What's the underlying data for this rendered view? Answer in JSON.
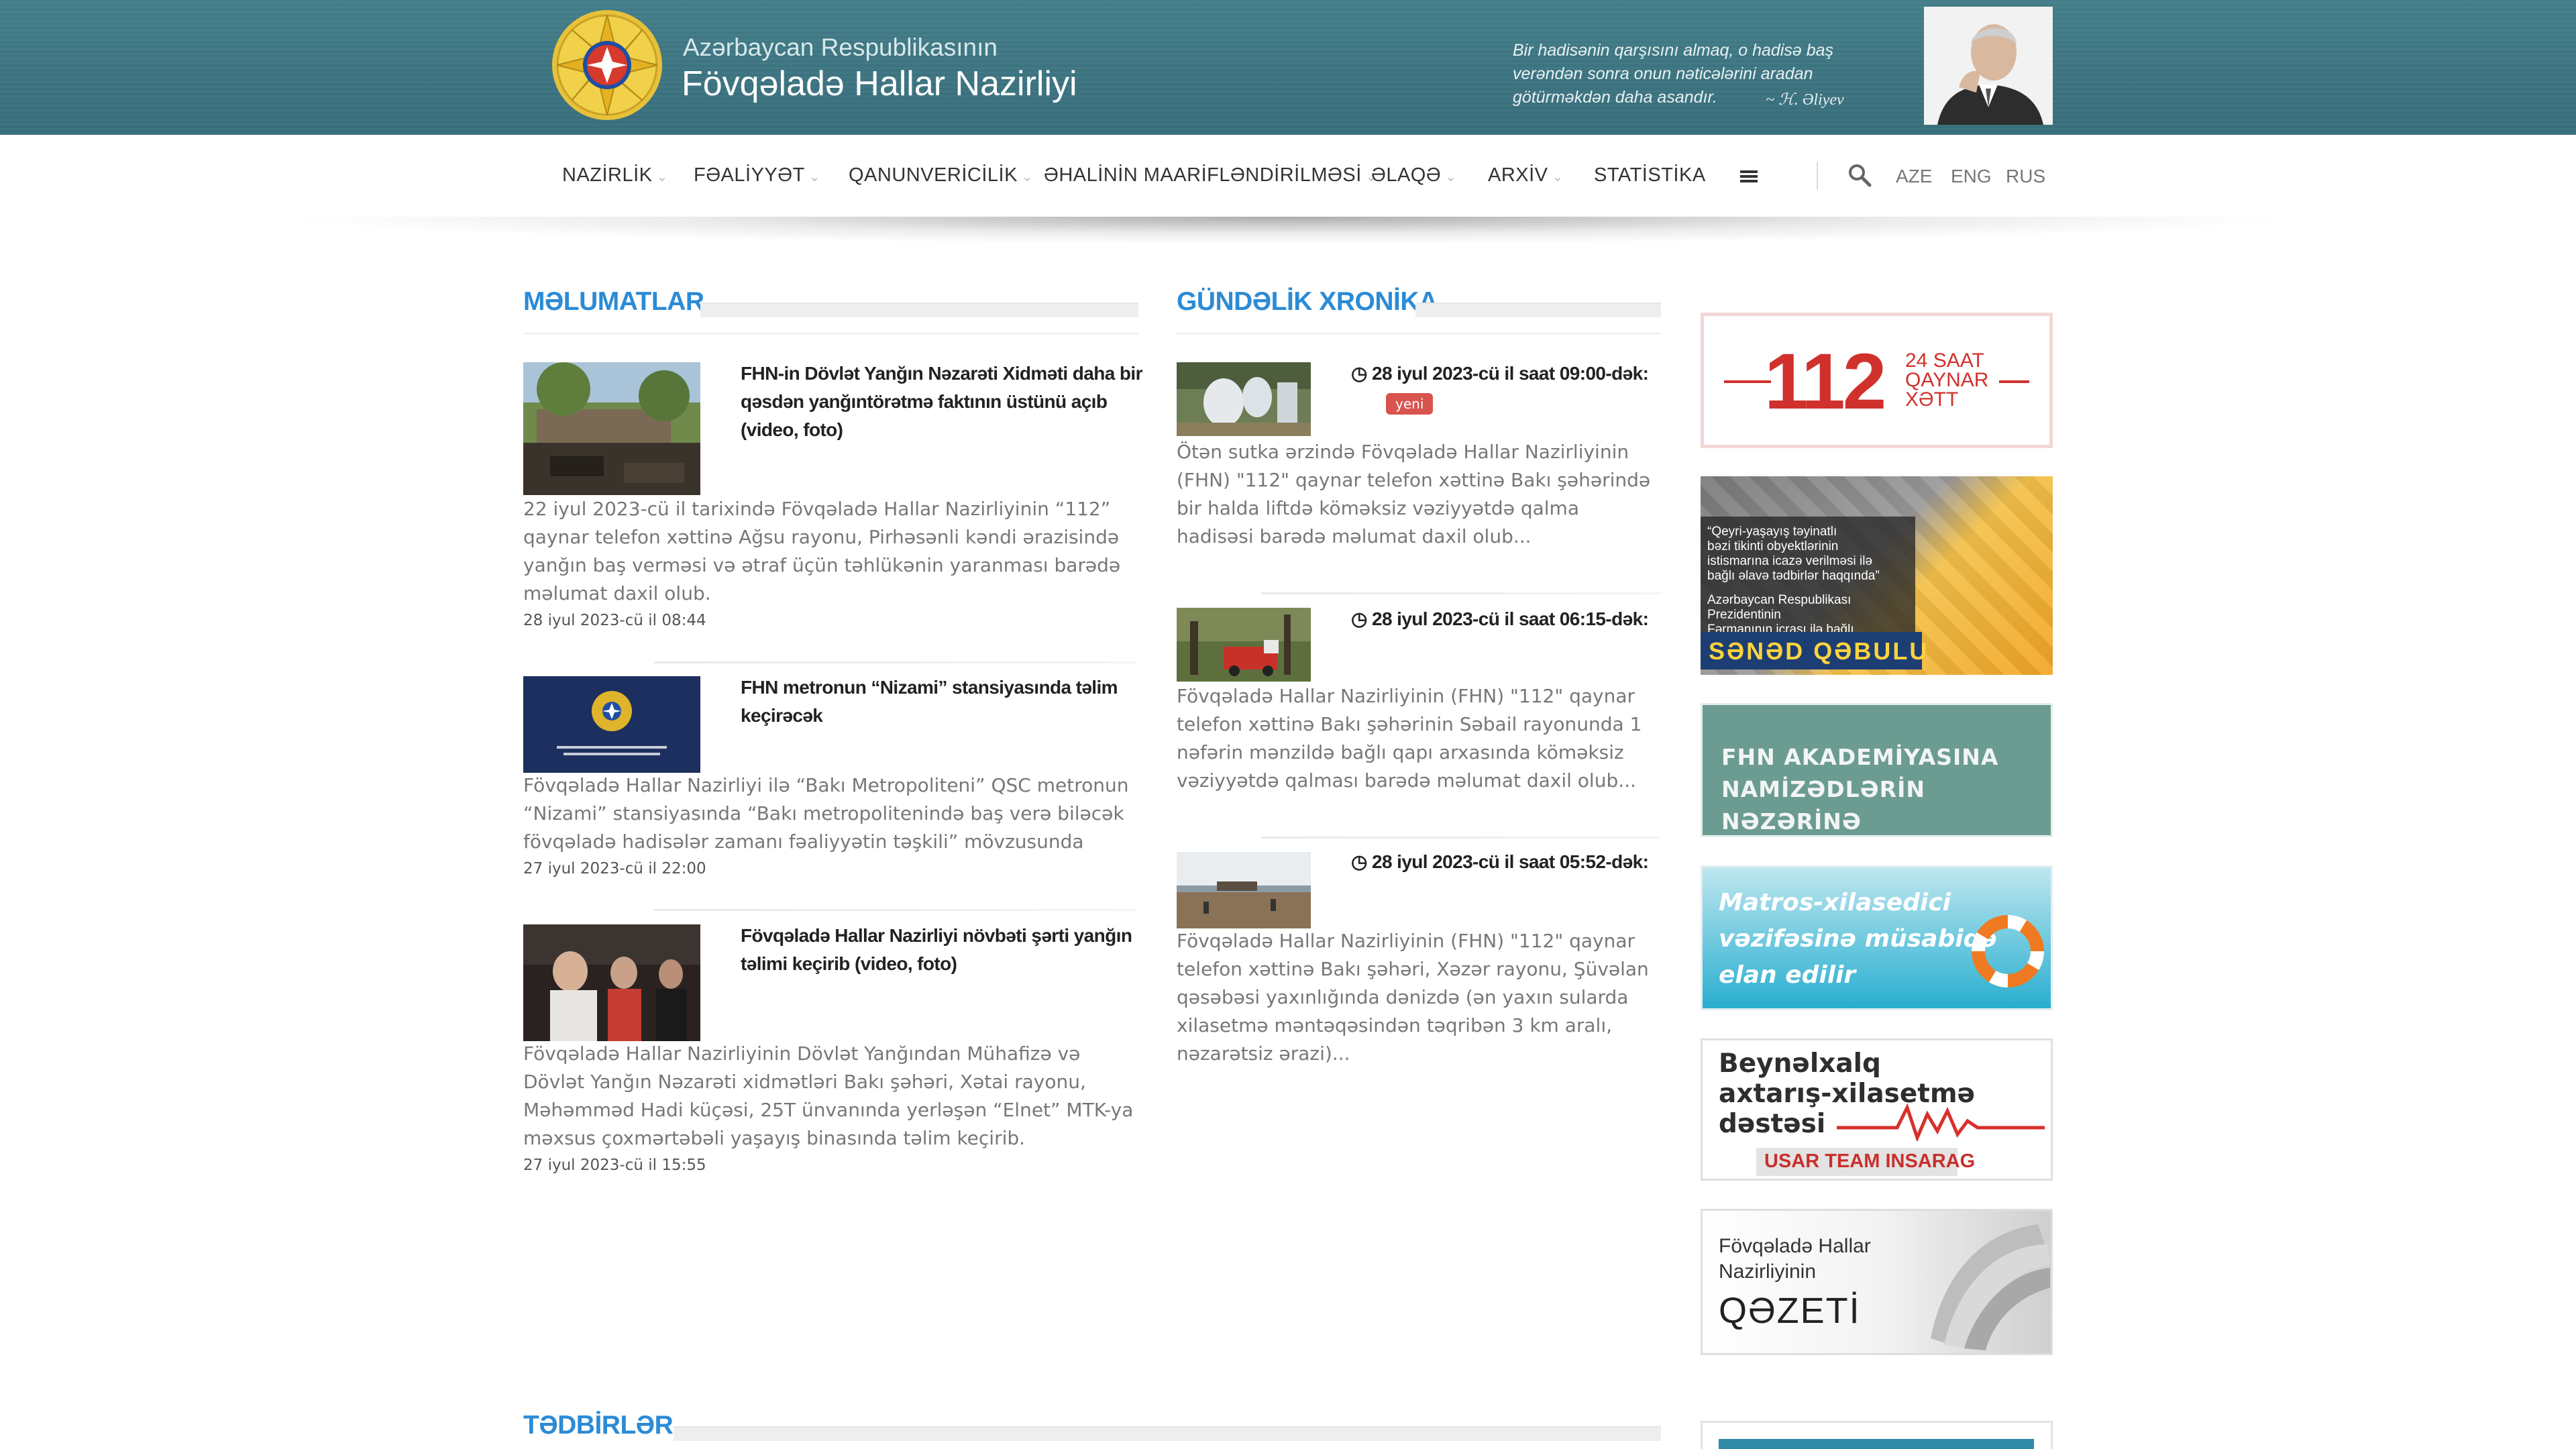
{
  "header": {
    "brand_sub": "Azərbaycan Respublikasının",
    "brand_main": "Fövqəladə Hallar Nazirliyi",
    "quote": "Bir hadisənin qarşısını almaq, o hadisə baş verəndən sonra onun nəticələrini aradan götürməkdən daha asandır."
  },
  "nav": {
    "items": [
      "NAZİRLİK",
      "FƏALİYYƏT",
      "QANUNVERİCİLİK",
      "ƏHALİNİN MAARİFLƏNDİRİLMƏSİ",
      "ƏLAQƏ",
      "ARXİV",
      "STATİSTİKA"
    ],
    "languages": [
      "AZE",
      "ENG",
      "RUS"
    ]
  },
  "sections": {
    "info_title": "MƏLUMATLAR",
    "chronicle_title": "GÜNDƏLİK XRONİKA",
    "events_title": "TƏDBİRLƏR"
  },
  "info_news": [
    {
      "title": "FHN-in Dövlət Yanğın Nəzarəti Xidməti daha bir qəsdən yanğıntörətmə faktının üstünü açıb (video, foto)",
      "excerpt": "22 iyul 2023-cü il tarixində Fövqəladə Hallar Nazirliyinin “112” qaynar telefon xəttinə Ağsu rayonu, Pirhəsənli kəndi ərazisində yanğın baş verməsi və ətraf üçün təhlükənin yaranması barədə məlumat daxil olub.",
      "date": "28 iyul 2023-cü il 08:44"
    },
    {
      "title": "FHN metronun “Nizami” stansiyasında təlim keçirəcək",
      "excerpt": "Fövqəladə Hallar Nazirliyi ilə “Bakı Metropoliteni” QSC metronun “Nizami” stansiyasında “Bakı metropolitenində baş verə biləcək fövqəladə hadisələr zamanı fəaliyyətin təşkili” mövzusunda",
      "date": "27 iyul 2023-cü il 22:00",
      "thumb_caption": "AZƏRBAYCAN RESPUBLİKASININ FÖVQƏLADƏ HALLAR NAZİRLİYİ"
    },
    {
      "title": "Fövqəladə Hallar Nazirliyi növbəti şərti yanğın təlimi keçirib (video, foto)",
      "excerpt": "Fövqəladə Hallar Nazirliyinin Dövlət Yanğından Mühafizə və Dövlət Yanğın Nəzarəti xidmətləri Bakı şəhəri, Xətai rayonu, Məhəmməd Hadi küçəsi, 25T ünvanında yerləşən “Elnet” MTK-ya məxsus çoxmərtəbəli yaşayış binasında təlim keçirib.",
      "date": "27 iyul 2023-cü il 15:55"
    }
  ],
  "chronicle": [
    {
      "time": "28 iyul 2023-cü il saat 09:00-dək:",
      "badge": "yeni",
      "excerpt": "Ötən sutka ərzində Fövqəladə Hallar Nazirliyinin (FHN) \"112\" qaynar telefon xəttinə Bakı şəhərində bir halda liftdə köməksiz vəziyyətdə qalma hadisəsi barədə məlumat daxil olub..."
    },
    {
      "time": "28 iyul 2023-cü il saat 06:15-dək:",
      "excerpt": "Fövqəladə Hallar Nazirliyinin (FHN) \"112\" qaynar telefon xəttinə Bakı şəhərinin Səbail rayonunda 1 nəfərin mənzildə bağlı qapı arxasında köməksiz vəziyyətdə qalması barədə məlumat daxil olub..."
    },
    {
      "time": "28 iyul 2023-cü il saat 05:52-dək:",
      "excerpt": "Fövqəladə Hallar Nazirliyinin (FHN) \"112\" qaynar telefon xəttinə Bakı şəhəri, Xəzər rayonu, Şüvəlan qəsəbəsi yaxınlığında dənizdə (ən yaxın sularda xilasetmə məntəqəsindən təqribən 3 km aralı, nəzarətsiz ərazi)..."
    }
  ],
  "banners": {
    "hotline_number": "112",
    "hotline_text": [
      "24 SAAT",
      "QAYNAR",
      "XƏTT"
    ],
    "docs_lines": [
      "“Qeyri-yaşayış təyinatlı",
      "bəzi tikinti obyektlərinin",
      "istismarına icazə verilməsi ilə",
      "bağlı əlavə tədbirlər haqqında”",
      "Azərbaycan Respublikası Prezidentinin",
      "Fərmanının icrası ilə bağlı"
    ],
    "docs_cta": "SƏNƏD QƏBULU",
    "academy_lines": [
      "FHN AKADEMİYASINA",
      "NAMİZƏDLƏRİN NƏZƏRİNƏ"
    ],
    "sailor_lines": [
      "Matros-xilasedici",
      "vəzifəsinə müsabiqə",
      "elan edilir"
    ],
    "usar_lines": [
      "Beynəlxalq",
      "axtarış-xilasetmə",
      "dəstəsi"
    ],
    "usar_tag": "USAR TEAM INSARAG",
    "newspaper_lines": [
      "Fövqəladə Hallar",
      "Nazirliyinin"
    ],
    "newspaper_title": "QƏZETİ"
  },
  "colors": {
    "accent": "#2b8bd6",
    "header_teal": "#3e7683",
    "badge_red": "#d9534f",
    "hotline_red": "#d0312d"
  }
}
